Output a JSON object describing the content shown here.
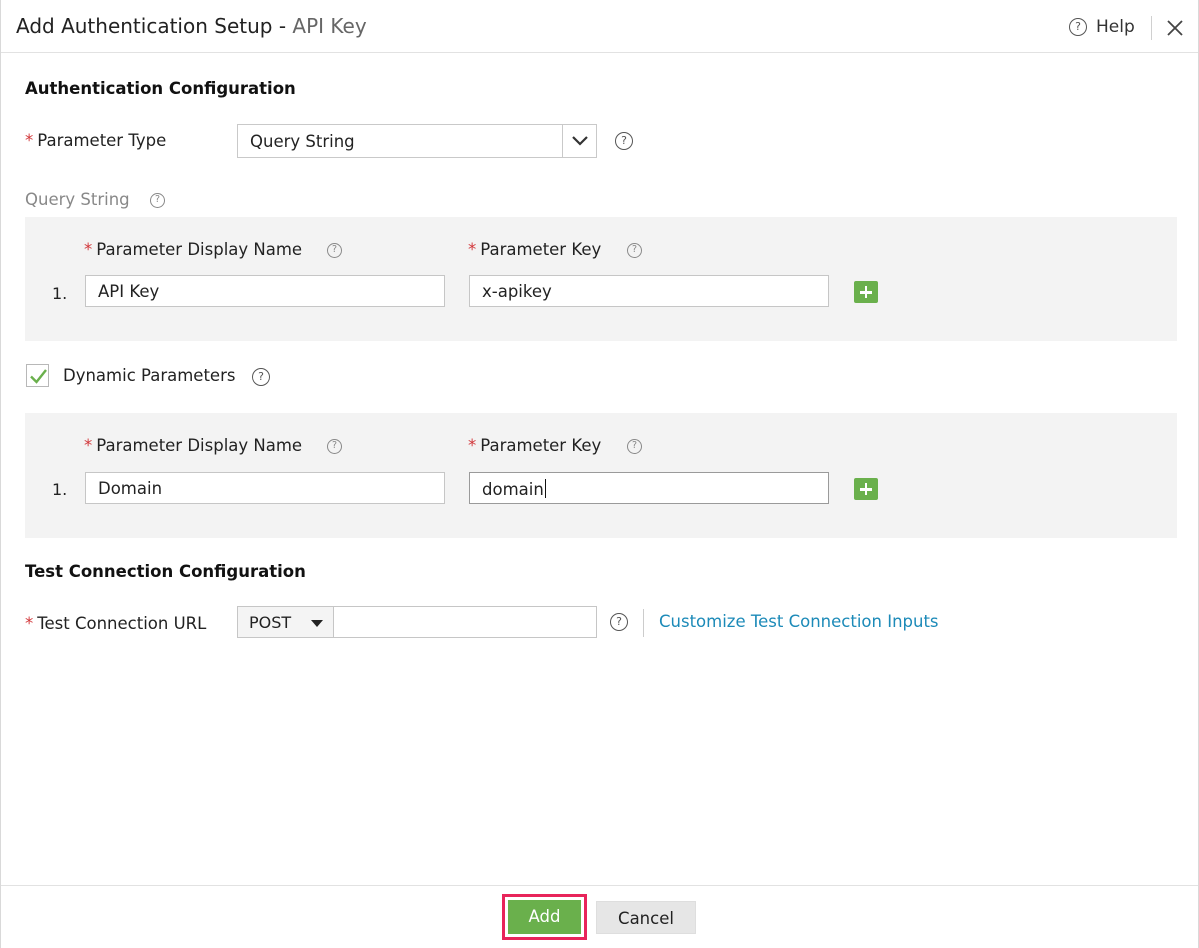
{
  "header": {
    "title_main": "Add Authentication Setup - ",
    "title_sub": "API Key",
    "help_label": "Help",
    "help_icon": "help-circle-icon",
    "close_icon": "close-icon"
  },
  "auth_config": {
    "section_title": "Authentication Configuration",
    "parameter_type_label": "Parameter Type",
    "parameter_type_value": "Query String"
  },
  "query_string": {
    "label": "Query String",
    "col_display_name": "Parameter Display Name",
    "col_key": "Parameter Key",
    "rows": [
      {
        "num": "1.",
        "display_name": "API Key",
        "key": "x-apikey"
      }
    ]
  },
  "dynamic_parameters": {
    "label": "Dynamic Parameters",
    "checked": true,
    "col_display_name": "Parameter Display Name",
    "col_key": "Parameter Key",
    "rows": [
      {
        "num": "1.",
        "display_name": "Domain",
        "key": "domain"
      }
    ]
  },
  "test_connection": {
    "section_title": "Test Connection Configuration",
    "url_label": "Test Connection URL",
    "method": "POST",
    "url_value": "",
    "customize_link": "Customize Test Connection Inputs"
  },
  "footer": {
    "add_label": "Add",
    "cancel_label": "Cancel"
  },
  "colors": {
    "accent_green": "#6ab04c",
    "required_red": "#d2383b",
    "link_blue": "#1c8ab8",
    "highlight_pink": "#e8245a"
  }
}
